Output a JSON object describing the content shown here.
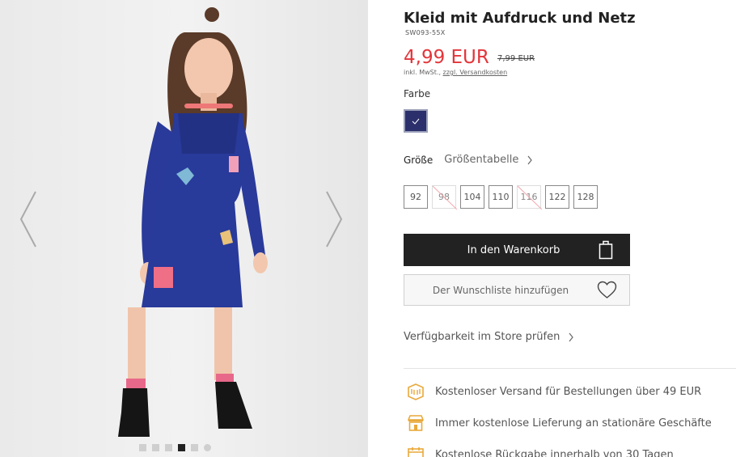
{
  "gallery": {
    "thumbnail_count": 6,
    "active_index": 3
  },
  "product": {
    "title": "Kleid mit Aufdruck und Netz",
    "sku": "SW093-55X",
    "price": "4,99 EUR",
    "old_price": "7,99 EUR",
    "tax_prefix": "inkl. MwSt., ",
    "shipping_link": "zzgl. Versandkosten"
  },
  "color": {
    "label": "Farbe",
    "selected": "#2b2f6b"
  },
  "size": {
    "label": "Größe",
    "guide_link": "Größentabelle",
    "options": [
      {
        "value": "92",
        "available": true
      },
      {
        "value": "98",
        "available": false
      },
      {
        "value": "104",
        "available": true
      },
      {
        "value": "110",
        "available": true
      },
      {
        "value": "116",
        "available": false
      },
      {
        "value": "122",
        "available": true
      },
      {
        "value": "128",
        "available": true
      }
    ]
  },
  "actions": {
    "add_to_cart": "In den Warenkorb",
    "add_to_wishlist": "Der Wunschliste hinzufügen"
  },
  "store": {
    "check_availability": "Verfügbarkeit im Store prüfen"
  },
  "benefits": [
    {
      "icon": "delivery-box-icon",
      "text": "Kostenloser Versand für Bestellungen über 49 EUR"
    },
    {
      "icon": "store-icon",
      "text": "Immer kostenlose Lieferung an stationäre Geschäfte"
    },
    {
      "icon": "calendar-icon",
      "text": "Kostenlose Rückgabe innerhalb von 30 Tagen"
    }
  ],
  "colors": {
    "accent": "#e4353a",
    "icon_gold": "#e9a93a",
    "button_dark": "#222222"
  }
}
